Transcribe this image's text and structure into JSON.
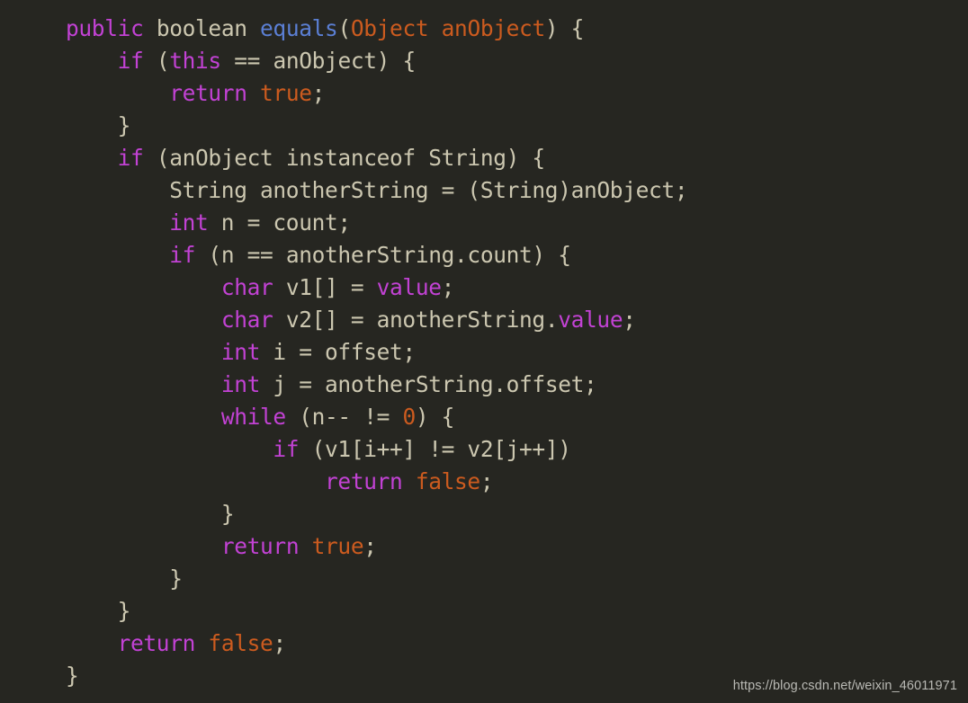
{
  "editor": {
    "language": "java",
    "background_color": "#262621",
    "default_text_color": "#ccc7b0",
    "keyword_color": "#c242d4",
    "literal_color": "#cc5b1f",
    "method_color": "#5b7fd4",
    "font_size_px": 24.5,
    "line_height_px": 36,
    "indent_spaces": 4
  },
  "code": {
    "lines": [
      {
        "indent": 0,
        "tokens": [
          {
            "t": "public",
            "c": "keyword"
          },
          {
            "t": " ",
            "c": "default"
          },
          {
            "t": "boolean",
            "c": "default"
          },
          {
            "t": " ",
            "c": "default"
          },
          {
            "t": "equals",
            "c": "method"
          },
          {
            "t": "(",
            "c": "punct"
          },
          {
            "t": "Object",
            "c": "type"
          },
          {
            "t": " ",
            "c": "default"
          },
          {
            "t": "anObject",
            "c": "type"
          },
          {
            "t": ") {",
            "c": "punct"
          }
        ]
      },
      {
        "indent": 1,
        "tokens": [
          {
            "t": "if",
            "c": "keyword"
          },
          {
            "t": " (",
            "c": "punct"
          },
          {
            "t": "this",
            "c": "keyword"
          },
          {
            "t": " == anObject) {",
            "c": "default"
          }
        ]
      },
      {
        "indent": 2,
        "tokens": [
          {
            "t": "return",
            "c": "keyword"
          },
          {
            "t": " ",
            "c": "default"
          },
          {
            "t": "true",
            "c": "literal"
          },
          {
            "t": ";",
            "c": "punct"
          }
        ]
      },
      {
        "indent": 1,
        "tokens": [
          {
            "t": "}",
            "c": "punct"
          }
        ]
      },
      {
        "indent": 1,
        "tokens": [
          {
            "t": "if",
            "c": "keyword"
          },
          {
            "t": " (anObject instanceof String) {",
            "c": "default"
          }
        ]
      },
      {
        "indent": 2,
        "tokens": [
          {
            "t": "String anotherString = (String)anObject;",
            "c": "default"
          }
        ]
      },
      {
        "indent": 2,
        "tokens": [
          {
            "t": "int",
            "c": "keyword"
          },
          {
            "t": " n = count;",
            "c": "default"
          }
        ]
      },
      {
        "indent": 2,
        "tokens": [
          {
            "t": "if",
            "c": "keyword"
          },
          {
            "t": " (n == anotherString.count) {",
            "c": "default"
          }
        ]
      },
      {
        "indent": 3,
        "tokens": [
          {
            "t": "char",
            "c": "keyword"
          },
          {
            "t": " v1[] = ",
            "c": "default"
          },
          {
            "t": "value",
            "c": "keyword"
          },
          {
            "t": ";",
            "c": "punct"
          }
        ]
      },
      {
        "indent": 3,
        "tokens": [
          {
            "t": "char",
            "c": "keyword"
          },
          {
            "t": " v2[] = anotherString.",
            "c": "default"
          },
          {
            "t": "value",
            "c": "keyword"
          },
          {
            "t": ";",
            "c": "punct"
          }
        ]
      },
      {
        "indent": 3,
        "tokens": [
          {
            "t": "int",
            "c": "keyword"
          },
          {
            "t": " i = offset;",
            "c": "default"
          }
        ]
      },
      {
        "indent": 3,
        "tokens": [
          {
            "t": "int",
            "c": "keyword"
          },
          {
            "t": " j = anotherString.offset;",
            "c": "default"
          }
        ]
      },
      {
        "indent": 3,
        "tokens": [
          {
            "t": "while",
            "c": "keyword"
          },
          {
            "t": " (n-- != ",
            "c": "default"
          },
          {
            "t": "0",
            "c": "literal"
          },
          {
            "t": ") {",
            "c": "punct"
          }
        ]
      },
      {
        "indent": 4,
        "tokens": [
          {
            "t": "if",
            "c": "keyword"
          },
          {
            "t": " (v1[i++] != v2[j++])",
            "c": "default"
          }
        ]
      },
      {
        "indent": 5,
        "tokens": [
          {
            "t": "return",
            "c": "keyword"
          },
          {
            "t": " ",
            "c": "default"
          },
          {
            "t": "false",
            "c": "literal"
          },
          {
            "t": ";",
            "c": "punct"
          }
        ]
      },
      {
        "indent": 3,
        "tokens": [
          {
            "t": "}",
            "c": "punct"
          }
        ]
      },
      {
        "indent": 3,
        "tokens": [
          {
            "t": "return",
            "c": "keyword"
          },
          {
            "t": " ",
            "c": "default"
          },
          {
            "t": "true",
            "c": "literal"
          },
          {
            "t": ";",
            "c": "punct"
          }
        ]
      },
      {
        "indent": 2,
        "tokens": [
          {
            "t": "}",
            "c": "punct"
          }
        ]
      },
      {
        "indent": 1,
        "tokens": [
          {
            "t": "}",
            "c": "punct"
          }
        ]
      },
      {
        "indent": 1,
        "tokens": [
          {
            "t": "return",
            "c": "keyword"
          },
          {
            "t": " ",
            "c": "default"
          },
          {
            "t": "false",
            "c": "literal"
          },
          {
            "t": ";",
            "c": "punct"
          }
        ]
      },
      {
        "indent": 0,
        "tokens": [
          {
            "t": "}",
            "c": "punct"
          }
        ]
      }
    ]
  },
  "watermark": {
    "text": "https://blog.csdn.net/weixin_46011971"
  }
}
